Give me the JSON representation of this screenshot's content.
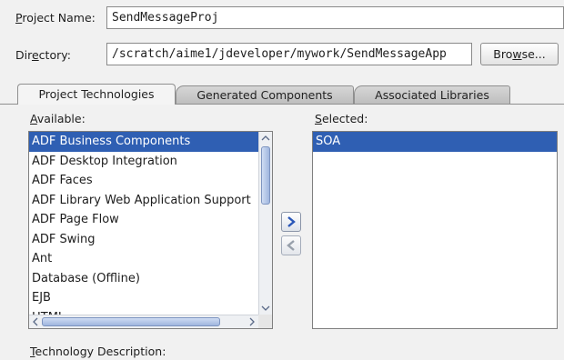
{
  "project": {
    "name_label_mnemonic": "P",
    "name_label_rest": "roject Name:",
    "name_value": "SendMessageProj",
    "dir_label_pre": "Dir",
    "dir_label_mnemonic": "e",
    "dir_label_post": "ctory:",
    "dir_value": "/scratch/aime1/jdeveloper/mywork/SendMessageApp",
    "browse_pre": "Bro",
    "browse_mnemonic": "w",
    "browse_post": "se..."
  },
  "tabs": [
    {
      "label": "Project Technologies",
      "active": true
    },
    {
      "label": "Generated Components",
      "active": false
    },
    {
      "label": "Associated Libraries",
      "active": false
    }
  ],
  "available": {
    "label_mnemonic": "A",
    "label_rest": "vailable:",
    "items": [
      "ADF Business Components",
      "ADF Desktop Integration",
      "ADF Faces",
      "ADF Library Web Application Support",
      "ADF Page Flow",
      "ADF Swing",
      "Ant",
      "Database (Offline)",
      "EJB",
      "HTML"
    ],
    "selected_index": 0
  },
  "selected": {
    "label_mnemonic": "S",
    "label_rest": "elected:",
    "items": [
      "SOA"
    ],
    "selected_index": 0
  },
  "description": {
    "label_mnemonic": "T",
    "label_rest": "echnology Description:"
  },
  "icons": {
    "add": "chevron-right-icon",
    "remove": "chevron-left-icon"
  },
  "colors": {
    "selection": "#2f5fb3",
    "window_bg": "#f1f1f1"
  }
}
